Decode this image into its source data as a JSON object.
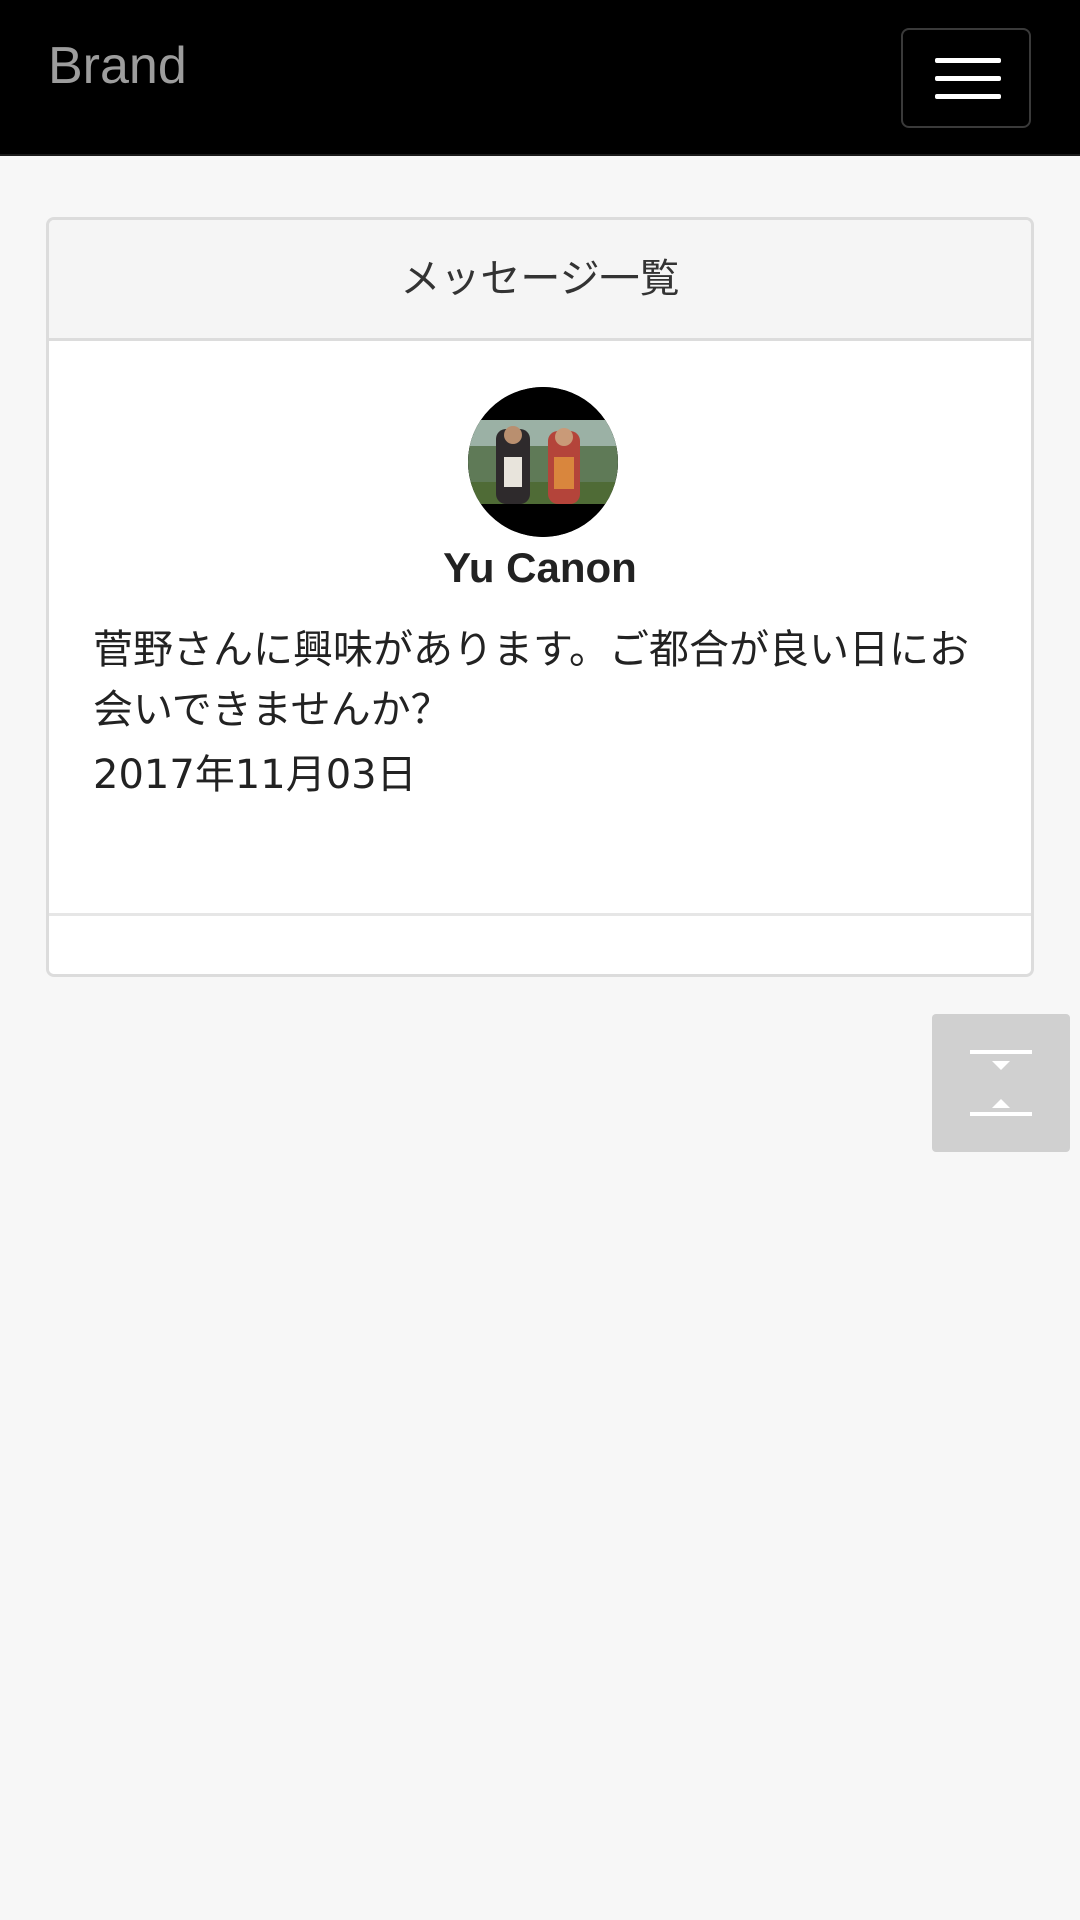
{
  "navbar": {
    "brand": "Brand",
    "menu_icon": "hamburger-menu-icon"
  },
  "panel": {
    "heading": "メッセージ一覧",
    "message": {
      "avatar_icon": "user-avatar-photo",
      "sender_name": "Yu Canon",
      "body": "菅野さんに興味があります。ご都合が良い日にお会いできませんか？",
      "date": "2017年11月03日"
    }
  },
  "scroll_button": {
    "icon": "scroll-top-bottom-icon"
  },
  "colors": {
    "navbar_bg": "#000000",
    "page_bg": "#f7f7f7",
    "panel_heading_bg": "#f5f5f5",
    "scroll_button_bg": "#d0d0d0"
  }
}
